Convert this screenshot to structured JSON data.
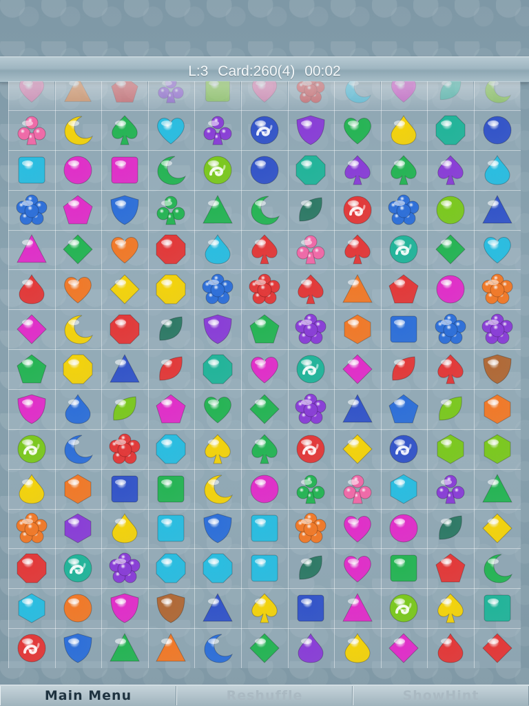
{
  "hud": {
    "level": "L:3",
    "cards": "Card:260(4)",
    "timer": "00:02"
  },
  "colors": {
    "pink": "#f06aa8",
    "red": "#e23a3a",
    "orange": "#f07a2a",
    "yellow": "#f2d20e",
    "lime": "#7cc820",
    "green": "#27b455",
    "teal": "#23b49a",
    "darkteal": "#2f7a66",
    "cyan": "#2bbde0",
    "blue": "#2f70d8",
    "navy": "#3455c8",
    "purple": "#8a3fd6",
    "magenta": "#e030c8",
    "brown": "#b06a38"
  },
  "top_row": [
    {
      "shape": "heart",
      "color": "pink"
    },
    {
      "shape": "triangle",
      "color": "orange"
    },
    {
      "shape": "pentagon",
      "color": "red"
    },
    {
      "shape": "club",
      "color": "purple"
    },
    {
      "shape": "square",
      "color": "lime"
    },
    {
      "shape": "heart",
      "color": "pink"
    },
    {
      "shape": "flower",
      "color": "red"
    },
    {
      "shape": "moon",
      "color": "cyan"
    },
    {
      "shape": "heart",
      "color": "magenta"
    },
    {
      "shape": "leaf",
      "color": "teal"
    },
    {
      "shape": "moon",
      "color": "lime"
    }
  ],
  "board": [
    [
      {
        "shape": "club",
        "color": "pink"
      },
      {
        "shape": "moon",
        "color": "yellow"
      },
      {
        "shape": "spade",
        "color": "green"
      },
      {
        "shape": "heart",
        "color": "cyan"
      },
      {
        "shape": "club",
        "color": "purple"
      },
      {
        "shape": "swirl",
        "color": "navy"
      },
      {
        "shape": "shield",
        "color": "purple"
      },
      {
        "shape": "heart",
        "color": "green"
      },
      {
        "shape": "drop",
        "color": "yellow"
      },
      {
        "shape": "octagon",
        "color": "teal"
      },
      {
        "shape": "circle",
        "color": "navy"
      }
    ],
    [
      {
        "shape": "square",
        "color": "cyan"
      },
      {
        "shape": "circle",
        "color": "magenta"
      },
      {
        "shape": "square",
        "color": "magenta"
      },
      {
        "shape": "moon",
        "color": "green"
      },
      {
        "shape": "swirl",
        "color": "lime"
      },
      {
        "shape": "circle",
        "color": "navy"
      },
      {
        "shape": "octagon",
        "color": "teal"
      },
      {
        "shape": "spade",
        "color": "purple"
      },
      {
        "shape": "spade",
        "color": "green"
      },
      {
        "shape": "spade",
        "color": "purple"
      },
      {
        "shape": "drop",
        "color": "cyan"
      }
    ],
    [
      {
        "shape": "flower",
        "color": "blue"
      },
      {
        "shape": "pentagon",
        "color": "magenta"
      },
      {
        "shape": "shield",
        "color": "blue"
      },
      {
        "shape": "club",
        "color": "green"
      },
      {
        "shape": "triangle",
        "color": "green"
      },
      {
        "shape": "moon",
        "color": "green"
      },
      {
        "shape": "leaf",
        "color": "darkteal"
      },
      {
        "shape": "swirl",
        "color": "red"
      },
      {
        "shape": "flower",
        "color": "blue"
      },
      {
        "shape": "circle",
        "color": "lime"
      },
      {
        "shape": "triangle",
        "color": "navy"
      }
    ],
    [
      {
        "shape": "triangle",
        "color": "magenta"
      },
      {
        "shape": "diamond",
        "color": "green"
      },
      {
        "shape": "heart",
        "color": "orange"
      },
      {
        "shape": "octagon",
        "color": "red"
      },
      {
        "shape": "drop",
        "color": "cyan"
      },
      {
        "shape": "spade",
        "color": "red"
      },
      {
        "shape": "club",
        "color": "pink"
      },
      {
        "shape": "spade",
        "color": "red"
      },
      {
        "shape": "swirl",
        "color": "teal"
      },
      {
        "shape": "diamond",
        "color": "green"
      },
      {
        "shape": "heart",
        "color": "cyan"
      }
    ],
    [
      {
        "shape": "drop",
        "color": "red"
      },
      {
        "shape": "heart",
        "color": "orange"
      },
      {
        "shape": "diamond",
        "color": "yellow"
      },
      {
        "shape": "octagon",
        "color": "yellow"
      },
      {
        "shape": "flower",
        "color": "blue"
      },
      {
        "shape": "flower",
        "color": "red"
      },
      {
        "shape": "spade",
        "color": "red"
      },
      {
        "shape": "triangle",
        "color": "orange"
      },
      {
        "shape": "pentagon",
        "color": "red"
      },
      {
        "shape": "circle",
        "color": "magenta"
      },
      {
        "shape": "flower",
        "color": "orange"
      }
    ],
    [
      {
        "shape": "diamond",
        "color": "magenta"
      },
      {
        "shape": "moon",
        "color": "yellow"
      },
      {
        "shape": "octagon",
        "color": "red"
      },
      {
        "shape": "leaf",
        "color": "darkteal"
      },
      {
        "shape": "shield",
        "color": "purple"
      },
      {
        "shape": "pentagon",
        "color": "green"
      },
      {
        "shape": "flower",
        "color": "purple"
      },
      {
        "shape": "hexagon",
        "color": "orange"
      },
      {
        "shape": "square",
        "color": "blue"
      },
      {
        "shape": "flower",
        "color": "blue"
      },
      {
        "shape": "flower",
        "color": "purple"
      }
    ],
    [
      {
        "shape": "pentagon",
        "color": "green"
      },
      {
        "shape": "octagon",
        "color": "yellow"
      },
      {
        "shape": "triangle",
        "color": "navy"
      },
      {
        "shape": "leaf",
        "color": "red"
      },
      {
        "shape": "octagon",
        "color": "teal"
      },
      {
        "shape": "heart",
        "color": "magenta"
      },
      {
        "shape": "swirl",
        "color": "teal"
      },
      {
        "shape": "diamond",
        "color": "magenta"
      },
      {
        "shape": "leaf",
        "color": "red"
      },
      {
        "shape": "spade",
        "color": "red"
      },
      {
        "shape": "shield",
        "color": "brown"
      }
    ],
    [
      {
        "shape": "shield",
        "color": "magenta"
      },
      {
        "shape": "drop",
        "color": "blue"
      },
      {
        "shape": "leaf",
        "color": "lime"
      },
      {
        "shape": "pentagon",
        "color": "magenta"
      },
      {
        "shape": "heart",
        "color": "green"
      },
      {
        "shape": "diamond",
        "color": "green"
      },
      {
        "shape": "flower",
        "color": "purple"
      },
      {
        "shape": "triangle",
        "color": "navy"
      },
      {
        "shape": "pentagon",
        "color": "blue"
      },
      {
        "shape": "leaf",
        "color": "lime"
      },
      {
        "shape": "hexagon",
        "color": "orange"
      }
    ],
    [
      {
        "shape": "swirl",
        "color": "lime"
      },
      {
        "shape": "moon",
        "color": "blue"
      },
      {
        "shape": "flower",
        "color": "red"
      },
      {
        "shape": "octagon",
        "color": "cyan"
      },
      {
        "shape": "spade",
        "color": "yellow"
      },
      {
        "shape": "spade",
        "color": "green"
      },
      {
        "shape": "swirl",
        "color": "red"
      },
      {
        "shape": "diamond",
        "color": "yellow"
      },
      {
        "shape": "swirl",
        "color": "navy"
      },
      {
        "shape": "hexagon",
        "color": "lime"
      },
      {
        "shape": "hexagon",
        "color": "lime"
      }
    ],
    [
      {
        "shape": "drop",
        "color": "yellow"
      },
      {
        "shape": "hexagon",
        "color": "orange"
      },
      {
        "shape": "square",
        "color": "navy"
      },
      {
        "shape": "square",
        "color": "green"
      },
      {
        "shape": "moon",
        "color": "yellow"
      },
      {
        "shape": "circle",
        "color": "magenta"
      },
      {
        "shape": "club",
        "color": "green"
      },
      {
        "shape": "club",
        "color": "pink"
      },
      {
        "shape": "hexagon",
        "color": "cyan"
      },
      {
        "shape": "club",
        "color": "purple"
      },
      {
        "shape": "triangle",
        "color": "green"
      }
    ],
    [
      {
        "shape": "flower",
        "color": "orange"
      },
      {
        "shape": "hexagon",
        "color": "purple"
      },
      {
        "shape": "drop",
        "color": "yellow"
      },
      {
        "shape": "square",
        "color": "cyan"
      },
      {
        "shape": "shield",
        "color": "blue"
      },
      {
        "shape": "square",
        "color": "cyan"
      },
      {
        "shape": "flower",
        "color": "orange"
      },
      {
        "shape": "heart",
        "color": "magenta"
      },
      {
        "shape": "circle",
        "color": "magenta"
      },
      {
        "shape": "leaf",
        "color": "darkteal"
      },
      {
        "shape": "diamond",
        "color": "yellow"
      }
    ],
    [
      {
        "shape": "octagon",
        "color": "red"
      },
      {
        "shape": "swirl",
        "color": "teal"
      },
      {
        "shape": "flower",
        "color": "purple"
      },
      {
        "shape": "octagon",
        "color": "cyan"
      },
      {
        "shape": "octagon",
        "color": "cyan"
      },
      {
        "shape": "square",
        "color": "cyan"
      },
      {
        "shape": "leaf",
        "color": "darkteal"
      },
      {
        "shape": "heart",
        "color": "magenta"
      },
      {
        "shape": "square",
        "color": "green"
      },
      {
        "shape": "pentagon",
        "color": "red"
      },
      {
        "shape": "moon",
        "color": "green"
      }
    ],
    [
      {
        "shape": "hexagon",
        "color": "cyan"
      },
      {
        "shape": "circle",
        "color": "orange"
      },
      {
        "shape": "shield",
        "color": "magenta"
      },
      {
        "shape": "shield",
        "color": "brown"
      },
      {
        "shape": "triangle",
        "color": "navy"
      },
      {
        "shape": "spade",
        "color": "yellow"
      },
      {
        "shape": "square",
        "color": "navy"
      },
      {
        "shape": "triangle",
        "color": "magenta"
      },
      {
        "shape": "swirl",
        "color": "lime"
      },
      {
        "shape": "spade",
        "color": "yellow"
      },
      {
        "shape": "square",
        "color": "teal"
      }
    ],
    [
      {
        "shape": "swirl",
        "color": "red"
      },
      {
        "shape": "shield",
        "color": "blue"
      },
      {
        "shape": "triangle",
        "color": "green"
      },
      {
        "shape": "triangle",
        "color": "orange"
      },
      {
        "shape": "moon",
        "color": "blue"
      },
      {
        "shape": "diamond",
        "color": "green"
      },
      {
        "shape": "drop",
        "color": "purple"
      },
      {
        "shape": "drop",
        "color": "yellow"
      },
      {
        "shape": "diamond",
        "color": "magenta"
      },
      {
        "shape": "drop",
        "color": "red"
      },
      {
        "shape": "diamond",
        "color": "red"
      }
    ]
  ],
  "buttons": {
    "main_menu": {
      "label": "Main Menu",
      "color": "#1f3340"
    },
    "reshuffle": {
      "label": "Reshuffle",
      "color": "#aab9c2"
    },
    "show_hint": {
      "label": "ShowHint",
      "color": "#aab9c2"
    }
  }
}
